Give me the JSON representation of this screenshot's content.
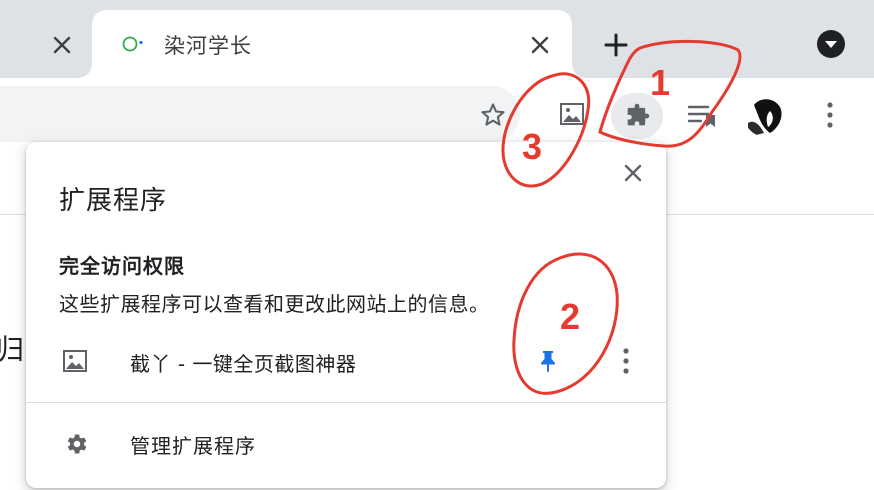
{
  "tabs": {
    "active_title": "染河学长"
  },
  "popup": {
    "title": "扩展程序",
    "section_heading": "完全访问权限",
    "section_description": "这些扩展程序可以查看和更改此网站上的信息。",
    "extensions": [
      {
        "name": "截丫 - 一键全页截图神器",
        "pinned": true,
        "icon": "image-icon"
      }
    ],
    "manage_label": "管理扩展程序"
  },
  "page": {
    "partial_glyph": "归"
  },
  "annotations": {
    "label_1": "1",
    "label_2": "2",
    "label_3": "3",
    "color": "#e53a2f"
  },
  "colors": {
    "tabstrip": "#dee1e6",
    "pin": "#1a73e8",
    "icon": "#5f6368"
  }
}
